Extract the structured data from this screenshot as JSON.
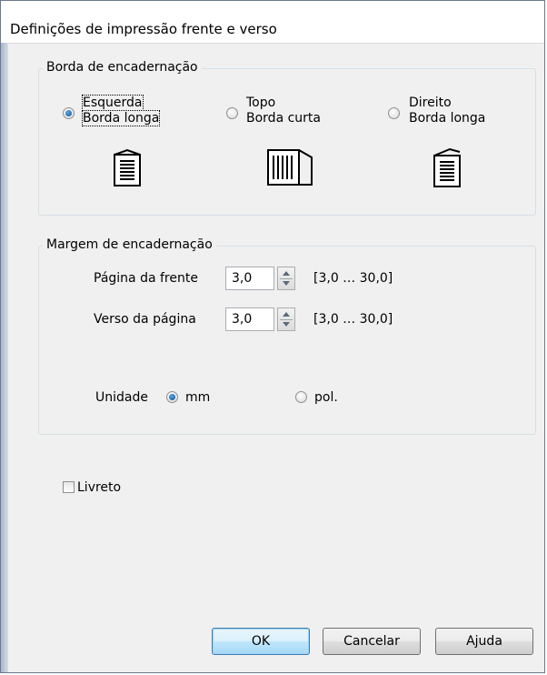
{
  "window": {
    "title": "Definições de impressão frente e verso"
  },
  "binding_edge": {
    "legend": "Borda de encadernação",
    "options": [
      {
        "line1": "Esquerda",
        "line2": "Borda longa",
        "checked": true,
        "icon": "portrait-page-left-binding-icon"
      },
      {
        "line1": "Topo",
        "line2": "Borda curta",
        "checked": false,
        "icon": "landscape-page-top-binding-icon"
      },
      {
        "line1": "Direito",
        "line2": "Borda longa",
        "checked": false,
        "icon": "portrait-page-right-binding-icon"
      }
    ]
  },
  "binding_margin": {
    "legend": "Margem de encadernação",
    "front_label": "Página da frente",
    "front_value": "3,0",
    "front_range": "[3,0 … 30,0]",
    "back_label": "Verso da página",
    "back_value": "3,0",
    "back_range": "[3,0 … 30,0]",
    "unit_label": "Unidade",
    "unit_mm": "mm",
    "unit_pol": "pol.",
    "selected_unit": "mm"
  },
  "booklet": {
    "label": "Livreto",
    "checked": false
  },
  "buttons": {
    "ok": "OK",
    "cancel": "Cancelar",
    "help": "Ajuda"
  }
}
